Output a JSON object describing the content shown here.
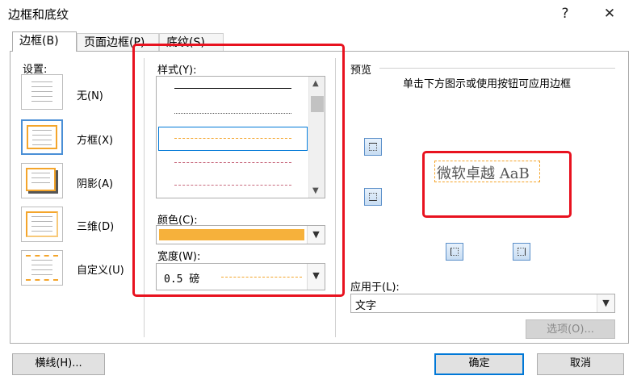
{
  "window": {
    "title": "边框和底纹",
    "help_label": "?",
    "close_label": "✕"
  },
  "tabs": [
    {
      "label": "边框(B)",
      "active": true
    },
    {
      "label": "页面边框(P)",
      "active": false
    },
    {
      "label": "底纹(S)",
      "active": false
    }
  ],
  "settings": {
    "header": "设置:",
    "items": [
      {
        "label": "无(N)",
        "icon": "none-border-icon"
      },
      {
        "label": "方框(X)",
        "icon": "box-border-icon"
      },
      {
        "label": "阴影(A)",
        "icon": "shadow-border-icon"
      },
      {
        "label": "三维(D)",
        "icon": "3d-border-icon"
      },
      {
        "label": "自定义(U)",
        "icon": "custom-border-icon"
      }
    ],
    "selected": "方框(X)"
  },
  "style": {
    "label": "样式(Y):",
    "options": [
      "solid",
      "dotted-fine",
      "dashed-orange",
      "dash-dot",
      "dash-dot-dot"
    ],
    "selected": "dashed-orange"
  },
  "color": {
    "label": "颜色(C):",
    "value_hex": "#f6b13b"
  },
  "width": {
    "label": "宽度(W):",
    "value": "0.5 磅"
  },
  "preview": {
    "header": "预览",
    "instruction": "单击下方图示或使用按钮可应用边框",
    "sample_text": "微软卓越  AaB",
    "buttons": [
      "top-border-icon",
      "bottom-border-icon",
      "left-border-icon",
      "right-border-icon"
    ]
  },
  "apply_to": {
    "label": "应用于(L):",
    "value": "文字"
  },
  "buttons": {
    "options": "选项(O)...",
    "horizontal_line": "横线(H)...",
    "ok": "确定",
    "cancel": "取消"
  },
  "colors": {
    "accent_orange": "#f4a52b",
    "highlight_red": "#e8121f",
    "selection_blue": "#0078d7"
  }
}
